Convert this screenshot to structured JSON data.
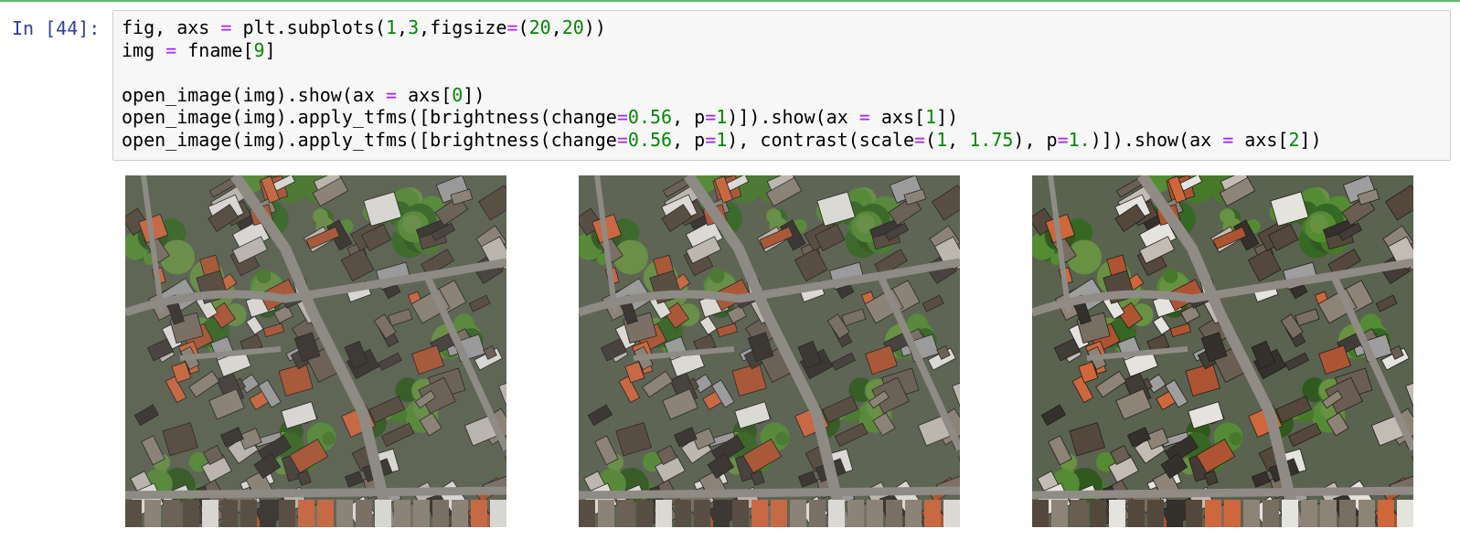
{
  "cell": {
    "prompt": "In [44]:",
    "code_lines": [
      [
        {
          "t": "fig, axs "
        },
        {
          "t": "=",
          "c": "op"
        },
        {
          "t": " plt.subplots("
        },
        {
          "t": "1",
          "c": "num"
        },
        {
          "t": ","
        },
        {
          "t": "3",
          "c": "num"
        },
        {
          "t": ",figsize"
        },
        {
          "t": "=",
          "c": "op"
        },
        {
          "t": "("
        },
        {
          "t": "20",
          "c": "num"
        },
        {
          "t": ","
        },
        {
          "t": "20",
          "c": "num"
        },
        {
          "t": "))"
        }
      ],
      [
        {
          "t": "img "
        },
        {
          "t": "=",
          "c": "op"
        },
        {
          "t": " fname["
        },
        {
          "t": "9",
          "c": "num"
        },
        {
          "t": "]"
        }
      ],
      [
        {
          "t": ""
        }
      ],
      [
        {
          "t": "open_image(img).show(ax "
        },
        {
          "t": "=",
          "c": "op"
        },
        {
          "t": " axs["
        },
        {
          "t": "0",
          "c": "num"
        },
        {
          "t": "])"
        }
      ],
      [
        {
          "t": "open_image(img).apply_tfms([brightness(change"
        },
        {
          "t": "=",
          "c": "op"
        },
        {
          "t": "0.56",
          "c": "num"
        },
        {
          "t": ", p"
        },
        {
          "t": "=",
          "c": "op"
        },
        {
          "t": "1",
          "c": "num"
        },
        {
          "t": ")]).show(ax "
        },
        {
          "t": "=",
          "c": "op"
        },
        {
          "t": " axs["
        },
        {
          "t": "1",
          "c": "num"
        },
        {
          "t": "])"
        }
      ],
      [
        {
          "t": "open_image(img).apply_tfms([brightness(change"
        },
        {
          "t": "=",
          "c": "op"
        },
        {
          "t": "0.56",
          "c": "num"
        },
        {
          "t": ", p"
        },
        {
          "t": "=",
          "c": "op"
        },
        {
          "t": "1",
          "c": "num"
        },
        {
          "t": "), contrast(scale"
        },
        {
          "t": "=",
          "c": "op"
        },
        {
          "t": "("
        },
        {
          "t": "1",
          "c": "num"
        },
        {
          "t": ", "
        },
        {
          "t": "1.75",
          "c": "num"
        },
        {
          "t": "), p"
        },
        {
          "t": "=",
          "c": "op"
        },
        {
          "t": "1.",
          "c": "num"
        },
        {
          "t": ")]).show(ax "
        },
        {
          "t": "=",
          "c": "op"
        },
        {
          "t": " axs["
        },
        {
          "t": "2",
          "c": "num"
        },
        {
          "t": "])"
        }
      ]
    ]
  },
  "output": {
    "images": [
      {
        "name": "axs-0-original",
        "contrast": 1.0
      },
      {
        "name": "axs-1-brightness",
        "contrast": 1.03
      },
      {
        "name": "axs-2-brightness-contrast",
        "contrast": 1.15
      }
    ]
  },
  "colors": {
    "prompt": "#303f9f",
    "operator": "#aa22ff",
    "number": "#008800",
    "editor_bg": "#f7f7f7"
  }
}
